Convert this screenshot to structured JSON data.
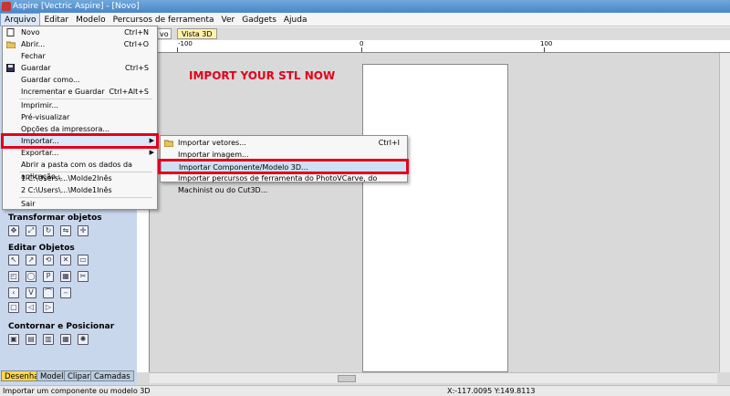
{
  "window": {
    "title": "Aspire [Vectric Aspire] - [Novo]"
  },
  "menubar": [
    "Arquivo",
    "Editar",
    "Modelo",
    "Percursos de ferramenta",
    "Ver",
    "Gadgets",
    "Ajuda"
  ],
  "doc_tabs": {
    "tab1": "vo",
    "tab2": "Vista 3D"
  },
  "ruler": {
    "h_labels": [
      "-100",
      "0",
      "100"
    ]
  },
  "annotation": "IMPORT YOUR STL NOW",
  "file_menu": {
    "items": [
      {
        "label": "Novo",
        "shortcut": "Ctrl+N",
        "icon": "new-file-icon"
      },
      {
        "label": "Abrir...",
        "shortcut": "Ctrl+O",
        "icon": "open-folder-icon"
      },
      {
        "label": "Fechar",
        "shortcut": ""
      },
      {
        "label": "Guardar",
        "shortcut": "Ctrl+S",
        "icon": "save-icon"
      },
      {
        "label": "Guardar como...",
        "shortcut": ""
      },
      {
        "label": "Incrementar e Guardar",
        "shortcut": "Ctrl+Alt+S"
      },
      {
        "label": "Imprimir...",
        "shortcut": ""
      },
      {
        "label": "Pré-visualizar",
        "shortcut": ""
      },
      {
        "label": "Opções da impressora...",
        "shortcut": ""
      },
      {
        "label": "Importar...",
        "shortcut": ""
      },
      {
        "label": "Exportar...",
        "shortcut": ""
      },
      {
        "label": "Abrir a pasta com os dados da aplicação...",
        "shortcut": ""
      },
      {
        "label": "1 C:\\Users\\...\\Molde2Inês",
        "shortcut": ""
      },
      {
        "label": "2 C:\\Users\\...\\Molde1Inês",
        "shortcut": ""
      },
      {
        "label": "Sair",
        "shortcut": ""
      }
    ]
  },
  "import_submenu": {
    "items": [
      {
        "label": "Importar vetores...",
        "shortcut": "Ctrl+I"
      },
      {
        "label": "Importar imagem...",
        "shortcut": ""
      },
      {
        "label": "Importar Componente/Modelo 3D...",
        "shortcut": ""
      },
      {
        "label": "Importar percursos de ferramenta do PhotoVCarve, do Machinist ou do Cut3D...",
        "shortcut": ""
      }
    ]
  },
  "left_panel": {
    "sections": [
      "Transformar objetos",
      "Editar Objetos",
      "Contornar e Posicionar"
    ],
    "tabs": [
      "Desenhar",
      "Modelar",
      "Clipart",
      "Camadas"
    ]
  },
  "status": {
    "text": "Importar um componente ou modelo 3D",
    "coords": "X:-117.0095 Y:149.8113"
  },
  "colors": {
    "highlight": "#e3001b",
    "panel": "#c9d7ec",
    "active_tab": "#ffd84d"
  }
}
